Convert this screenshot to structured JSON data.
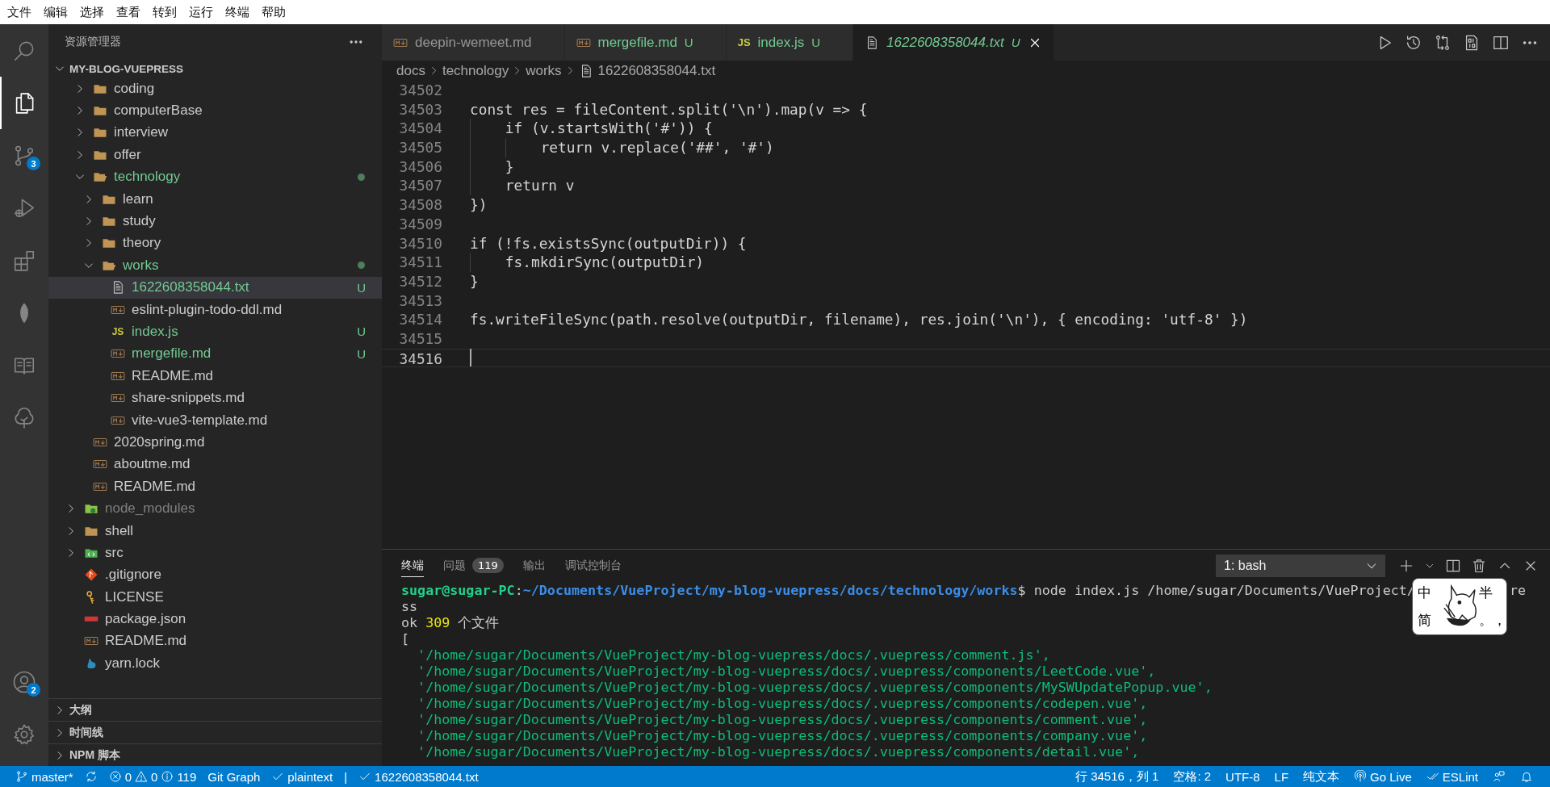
{
  "menu": [
    "文件",
    "编辑",
    "选择",
    "查看",
    "转到",
    "运行",
    "终端",
    "帮助"
  ],
  "activity_bar": [
    {
      "kind": "search",
      "selected": false
    },
    {
      "kind": "explorer",
      "selected": true
    },
    {
      "kind": "source-control",
      "selected": false,
      "badge": "3"
    },
    {
      "kind": "run",
      "selected": false
    },
    {
      "kind": "extensions",
      "selected": false
    },
    {
      "kind": "leaf",
      "selected": false
    },
    {
      "kind": "book",
      "selected": false
    },
    {
      "kind": "tree",
      "selected": false
    }
  ],
  "activity_bottom": [
    {
      "kind": "account",
      "badge": "2"
    },
    {
      "kind": "settings"
    }
  ],
  "sidebar": {
    "title": "资源管理器",
    "root": {
      "label": "MY-BLOG-VUEPRESS",
      "expanded": true
    },
    "tree": [
      {
        "children": [
          {
            "label": "coding",
            "kind": "folder",
            "expanded": false,
            "selected": false,
            "changed": false,
            "ignored": false
          },
          {
            "label": "computerBase",
            "kind": "folder",
            "expanded": false,
            "selected": false,
            "changed": false,
            "ignored": false
          },
          {
            "label": "interview",
            "kind": "folder",
            "expanded": false,
            "selected": false,
            "changed": false,
            "ignored": false
          },
          {
            "label": "offer",
            "kind": "folder",
            "expanded": false,
            "selected": false,
            "changed": false,
            "ignored": false
          },
          {
            "label": "technology",
            "kind": "folder",
            "expanded": true,
            "selected": false,
            "changed": true,
            "ignored": false,
            "children": [
              {
                "label": "learn",
                "kind": "folder",
                "expanded": false,
                "selected": false,
                "changed": false,
                "ignored": false
              },
              {
                "label": "study",
                "kind": "folder",
                "expanded": false,
                "selected": false,
                "changed": false,
                "ignored": false
              },
              {
                "label": "theory",
                "kind": "folder",
                "expanded": false,
                "selected": false,
                "changed": false,
                "ignored": false
              },
              {
                "label": "works",
                "kind": "folder",
                "expanded": true,
                "selected": false,
                "changed": true,
                "ignored": false,
                "children": [
                  {
                    "label": "1622608358044.txt",
                    "kind": "text",
                    "selected": true,
                    "changed": true,
                    "ignored": false,
                    "decoration": "U"
                  },
                  {
                    "label": "eslint-plugin-todo-ddl.md",
                    "kind": "markdown",
                    "selected": false,
                    "changed": false,
                    "ignored": false
                  },
                  {
                    "label": "index.js",
                    "kind": "js",
                    "icon_text": "JS",
                    "selected": false,
                    "changed": true,
                    "ignored": false,
                    "decoration": "U"
                  },
                  {
                    "label": "mergefile.md",
                    "kind": "markdown",
                    "selected": false,
                    "changed": true,
                    "ignored": false,
                    "decoration": "U"
                  },
                  {
                    "label": "README.md",
                    "kind": "markdown",
                    "selected": false,
                    "changed": false,
                    "ignored": false
                  },
                  {
                    "label": "share-snippets.md",
                    "kind": "markdown",
                    "selected": false,
                    "changed": false,
                    "ignored": false
                  },
                  {
                    "label": "vite-vue3-template.md",
                    "kind": "markdown",
                    "selected": false,
                    "changed": false,
                    "ignored": false
                  }
                ]
              }
            ]
          },
          {
            "label": "2020spring.md",
            "kind": "markdown",
            "selected": false,
            "changed": false,
            "ignored": false
          },
          {
            "label": "aboutme.md",
            "kind": "markdown",
            "selected": false,
            "changed": false,
            "ignored": false
          },
          {
            "label": "README.md",
            "kind": "markdown",
            "selected": false,
            "changed": false,
            "ignored": false
          }
        ]
      },
      {
        "label": "node_modules",
        "kind": "node-folder",
        "expanded": false,
        "selected": false,
        "changed": false,
        "ignored": true
      },
      {
        "label": "shell",
        "kind": "folder",
        "expanded": false,
        "selected": false,
        "changed": false,
        "ignored": false
      },
      {
        "label": "src",
        "kind": "src-folder",
        "expanded": false,
        "selected": false,
        "changed": false,
        "ignored": false
      },
      {
        "label": ".gitignore",
        "kind": "git",
        "selected": false,
        "changed": false,
        "ignored": false
      },
      {
        "label": "LICENSE",
        "kind": "license",
        "selected": false,
        "changed": false,
        "ignored": false
      },
      {
        "label": "package.json",
        "kind": "npm",
        "selected": false,
        "changed": false,
        "ignored": false
      },
      {
        "label": "README.md",
        "kind": "markdown",
        "selected": false,
        "changed": false,
        "ignored": false
      },
      {
        "label": "yarn.lock",
        "kind": "yarn",
        "selected": false,
        "changed": false,
        "ignored": false
      }
    ],
    "sections": [
      {
        "label": "大纲",
        "expanded": false
      },
      {
        "label": "时间线",
        "expanded": false
      },
      {
        "label": "NPM 脚本",
        "expanded": false
      }
    ]
  },
  "editor": {
    "tabs": [
      {
        "label": "deepin-wemeet.md",
        "kind": "markdown",
        "changed": false,
        "selected": false,
        "preview": false
      },
      {
        "label": "mergefile.md",
        "kind": "markdown",
        "changed": true,
        "decoration": "U",
        "selected": false,
        "preview": false
      },
      {
        "label": "index.js",
        "kind": "js",
        "icon_text": "JS",
        "changed": true,
        "decoration": "U",
        "selected": false,
        "preview": false
      },
      {
        "label": "1622608358044.txt",
        "kind": "text",
        "changed": true,
        "decoration": "U",
        "selected": true,
        "preview": true
      }
    ],
    "actions": [
      {
        "kind": "run"
      },
      {
        "kind": "history"
      },
      {
        "kind": "compare"
      },
      {
        "kind": "binary"
      },
      {
        "kind": "split"
      },
      {
        "kind": "more"
      }
    ],
    "breadcrumb": [
      {
        "label": "docs",
        "kind": "folder"
      },
      {
        "label": "technology",
        "kind": "folder"
      },
      {
        "label": "works",
        "kind": "folder"
      },
      {
        "label": "1622608358044.txt",
        "kind": "text"
      }
    ],
    "lines": [
      {
        "number": "34502",
        "current": false
      },
      {
        "number": "34503",
        "text": "const res = fileContent.split('\\n').map(v => {",
        "current": false
      },
      {
        "number": "34504",
        "text": "    if (v.startsWith('#')) {",
        "current": false
      },
      {
        "number": "34505",
        "text": "        return v.replace('##', '#')",
        "current": false
      },
      {
        "number": "34506",
        "text": "    }",
        "current": false
      },
      {
        "number": "34507",
        "text": "    return v",
        "current": false
      },
      {
        "number": "34508",
        "text": "})",
        "current": false
      },
      {
        "number": "34509",
        "current": false
      },
      {
        "number": "34510",
        "text": "if (!fs.existsSync(outputDir)) {",
        "current": false
      },
      {
        "number": "34511",
        "text": "    fs.mkdirSync(outputDir)",
        "current": false
      },
      {
        "number": "34512",
        "text": "}",
        "current": false
      },
      {
        "number": "34513",
        "current": false
      },
      {
        "number": "34514",
        "text": "fs.writeFileSync(path.resolve(outputDir, filename), res.join('\\n'), { encoding: 'utf-8' })",
        "current": false
      },
      {
        "number": "34515",
        "current": false
      },
      {
        "number": "34516",
        "current": true
      }
    ]
  },
  "panel": {
    "tabs": [
      {
        "label": "终端",
        "selected": true
      },
      {
        "label": "问题",
        "selected": false,
        "count": "119"
      },
      {
        "label": "输出",
        "selected": false
      },
      {
        "label": "调试控制台",
        "selected": false
      }
    ],
    "terminal_picker": "1: bash",
    "actions": [
      {
        "kind": "plus"
      },
      {
        "kind": "chevron-down"
      },
      {
        "kind": "split"
      },
      {
        "kind": "trash"
      },
      {
        "kind": "chevron-up"
      },
      {
        "kind": "close"
      }
    ],
    "terminal": [
      {
        "kind": "prompt",
        "user": "sugar@sugar-PC",
        "separator": ":",
        "path": "~/Documents/VueProject/my-blog-vuepress/docs/technology/works",
        "command": "$ node index.js /home/sugar/Documents/VueProject/",
        "tail": "re"
      },
      {
        "kind": "plain",
        "text": "ss"
      },
      {
        "kind": "count",
        "prefix": "ok ",
        "number": "309",
        "suffix": " 个文件"
      },
      {
        "kind": "plain",
        "text": "["
      },
      {
        "kind": "string",
        "text": "  '/home/sugar/Documents/VueProject/my-blog-vuepress/docs/.vuepress/comment.js',"
      },
      {
        "kind": "string",
        "text": "  '/home/sugar/Documents/VueProject/my-blog-vuepress/docs/.vuepress/components/LeetCode.vue',"
      },
      {
        "kind": "string",
        "text": "  '/home/sugar/Documents/VueProject/my-blog-vuepress/docs/.vuepress/components/MySWUpdatePopup.vue',"
      },
      {
        "kind": "string",
        "text": "  '/home/sugar/Documents/VueProject/my-blog-vuepress/docs/.vuepress/components/codepen.vue',"
      },
      {
        "kind": "string",
        "text": "  '/home/sugar/Documents/VueProject/my-blog-vuepress/docs/.vuepress/components/comment.vue',"
      },
      {
        "kind": "string",
        "text": "  '/home/sugar/Documents/VueProject/my-blog-vuepress/docs/.vuepress/components/company.vue',"
      },
      {
        "kind": "string",
        "text": "  '/home/sugar/Documents/VueProject/my-blog-vuepress/docs/.vuepress/components/detail.vue',"
      }
    ],
    "ime": {
      "mode": "中",
      "width": "半",
      "script": "简",
      "punctuation": "。，"
    }
  },
  "status_bar": {
    "left": [
      {
        "kind": "branch",
        "text": "master*"
      },
      {
        "kind": "sync"
      },
      {
        "kind": "problems",
        "errors": "0",
        "warnings": "0",
        "infos": "119"
      },
      {
        "kind": "plain",
        "text": "Git Graph"
      },
      {
        "kind": "check",
        "text": "plaintext"
      },
      {
        "kind": "plain",
        "text": "|"
      },
      {
        "kind": "check",
        "text": "1622608358044.txt"
      }
    ],
    "right": [
      {
        "kind": "plain",
        "text": "行 34516，列 1"
      },
      {
        "kind": "plain",
        "text": "空格: 2"
      },
      {
        "kind": "plain",
        "text": "UTF-8"
      },
      {
        "kind": "plain",
        "text": "LF"
      },
      {
        "kind": "plain",
        "text": "纯文本"
      },
      {
        "kind": "golive",
        "text": "Go Live"
      },
      {
        "kind": "eslint",
        "text": "ESLint"
      },
      {
        "kind": "feedback"
      },
      {
        "kind": "bell"
      }
    ]
  }
}
